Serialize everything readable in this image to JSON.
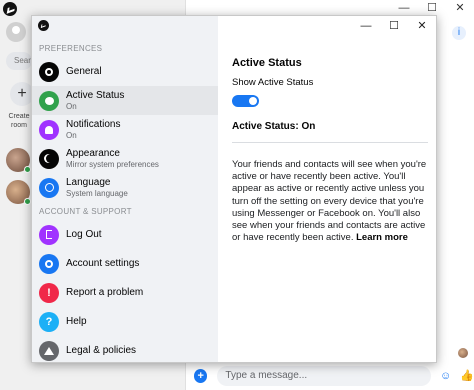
{
  "background": {
    "search_placeholder": "Sear",
    "create_room_label": "Create room",
    "composer_placeholder": "Type a message...",
    "window_controls": {
      "minimize": "—",
      "maximize": "☐",
      "close": "✕"
    }
  },
  "dialog": {
    "window_controls": {
      "minimize": "—",
      "maximize": "☐",
      "close": "✕"
    },
    "sections": {
      "preferences": "PREFERENCES",
      "account_support": "ACCOUNT & SUPPORT"
    },
    "menu": [
      {
        "label": "General",
        "sub": "",
        "icon": "gear-icon",
        "color": "#050505"
      },
      {
        "label": "Active Status",
        "sub": "On",
        "icon": "active-status-icon",
        "color": "#31a24c"
      },
      {
        "label": "Notifications",
        "sub": "On",
        "icon": "bell-icon",
        "color": "#a033ff"
      },
      {
        "label": "Appearance",
        "sub": "Mirror system preferences",
        "icon": "moon-icon",
        "color": "#050505"
      },
      {
        "label": "Language",
        "sub": "System language",
        "icon": "globe-icon",
        "color": "#1877f2"
      },
      {
        "label": "Log Out",
        "sub": "",
        "icon": "logout-icon",
        "color": "#a033ff"
      },
      {
        "label": "Account settings",
        "sub": "",
        "icon": "gear-icon",
        "color": "#1877f2"
      },
      {
        "label": "Report a problem",
        "sub": "",
        "icon": "warning-icon",
        "color": "#f02849"
      },
      {
        "label": "Help",
        "sub": "",
        "icon": "help-icon",
        "color": "#1cb0f6"
      },
      {
        "label": "Legal & policies",
        "sub": "",
        "icon": "legal-icon",
        "color": "#65676b"
      }
    ],
    "content": {
      "title": "Active Status",
      "toggle_label": "Show Active Status",
      "toggle_on": true,
      "status_text": "Active Status: On",
      "description": "Your friends and contacts will see when you're active or have recently been active. You'll appear as active or recently active unless you turn off the setting on every device that you're using Messenger or Facebook on. You'll also see when your friends and contacts are active or have recently been active.",
      "learn_more": "Learn more"
    }
  },
  "colors": {
    "accent": "#1877f2",
    "sidebar_bg": "#f0f2f5",
    "active_item_bg": "#e4e6e9"
  }
}
